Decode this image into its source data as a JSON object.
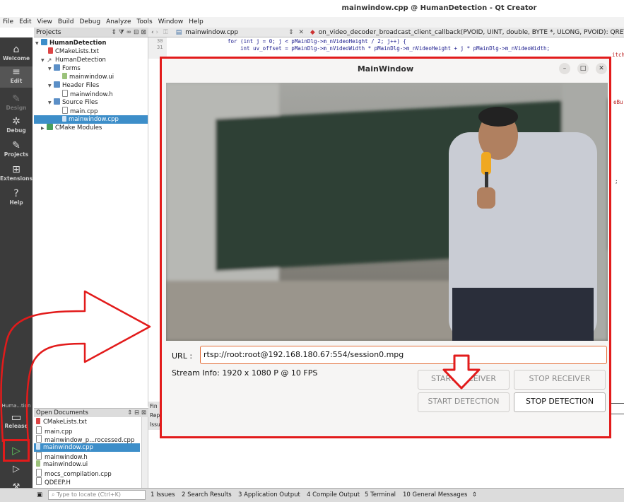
{
  "window_title": "mainwindow.cpp @ HumanDetection - Qt Creator",
  "menu": [
    "File",
    "Edit",
    "View",
    "Build",
    "Debug",
    "Analyze",
    "Tools",
    "Window",
    "Help"
  ],
  "projects_label": "Projects",
  "editor_tab": {
    "file": "mainwindow.cpp",
    "function": "on_video_decoder_broadcast_client_callback(PVOID, UINT, double, BYTE *, ULONG, PVOID): QRETURN"
  },
  "code_lines": [
    {
      "num": "30",
      "text": "for (int j = 0; j < pMainDlg->m_nVideoHeight / 2; j++) {"
    },
    {
      "num": "31",
      "text": "int uv_offset = pMainDlg->m_nVideoWidth * pMainDlg->m_nVideoHeight + j * pMainDlg->m_nVideoWidth;"
    }
  ],
  "code_fragments": {
    "right1": "itch",
    "right2": "eBu",
    "right3": ";"
  },
  "modes": [
    {
      "label": "Welcome",
      "icon": "home-icon",
      "glyph": "⌂"
    },
    {
      "label": "Edit",
      "icon": "edit-icon",
      "glyph": "≡"
    },
    {
      "label": "Design",
      "icon": "design-icon",
      "glyph": "✎"
    },
    {
      "label": "Debug",
      "icon": "debug-icon",
      "glyph": "✲"
    },
    {
      "label": "Projects",
      "icon": "projects-icon",
      "glyph": "✎"
    },
    {
      "label": "Extensions",
      "icon": "extensions-icon",
      "glyph": "⊞"
    },
    {
      "label": "Help",
      "icon": "help-icon",
      "glyph": "?"
    }
  ],
  "kit": {
    "name": "Huma...tion",
    "config": "Release"
  },
  "tree": [
    {
      "label": "HumanDetection",
      "level": 0,
      "bold": true,
      "type": "project"
    },
    {
      "label": "CMakeLists.txt",
      "level": 1,
      "type": "cmake"
    },
    {
      "label": "HumanDetection",
      "level": 1,
      "type": "target"
    },
    {
      "label": "Forms",
      "level": 2,
      "type": "folder"
    },
    {
      "label": "mainwindow.ui",
      "level": 3,
      "type": "ui"
    },
    {
      "label": "Header Files",
      "level": 2,
      "type": "folder"
    },
    {
      "label": "mainwindow.h",
      "level": 3,
      "type": "h"
    },
    {
      "label": "Source Files",
      "level": 2,
      "type": "folder"
    },
    {
      "label": "main.cpp",
      "level": 3,
      "type": "cpp"
    },
    {
      "label": "mainwindow.cpp",
      "level": 3,
      "type": "cpp",
      "selected": true
    },
    {
      "label": "CMake Modules",
      "level": 1,
      "type": "folder"
    }
  ],
  "open_documents_label": "Open Documents",
  "open_documents": [
    {
      "label": "CMakeLists.txt",
      "type": "cmake"
    },
    {
      "label": "main.cpp",
      "type": "cpp"
    },
    {
      "label": "mainwindow_p...rocessed.cpp",
      "type": "cpp"
    },
    {
      "label": "mainwindow.cpp",
      "type": "cpp",
      "selected": true
    },
    {
      "label": "mainwindow.h",
      "type": "h"
    },
    {
      "label": "mainwindow.ui",
      "type": "ui"
    },
    {
      "label": "mocs_compilation.cpp",
      "type": "cpp"
    },
    {
      "label": "QDEEP.H",
      "type": "h"
    }
  ],
  "locator_placeholder": "Type to locate (Ctrl+K)",
  "output_tabs": [
    "1 Issues",
    "2 Search Results",
    "3 Application Output",
    "4 Compile Output",
    "5 Terminal",
    "10 General Messages"
  ],
  "side_labels": {
    "find": "Fin",
    "rep": "Rep",
    "iss": "Issu"
  },
  "app_window": {
    "title": "MainWindow",
    "url_label": "URL :",
    "url_value": "rtsp://root:root@192.168.180.67:554/session0.mpg",
    "stream_info": "Stream Info: 1920 x 1080 P  @ 10 FPS",
    "buttons": {
      "start_receiver": "START RECEIVER",
      "stop_receiver": "STOP RECEIVER",
      "start_detection": "START DETECTION",
      "stop_detection": "STOP DETECTION"
    }
  },
  "colors": {
    "annotation_red": "#e21b1b",
    "selection_blue": "#3d8ec9",
    "sidebar": "#3b3b3b"
  }
}
